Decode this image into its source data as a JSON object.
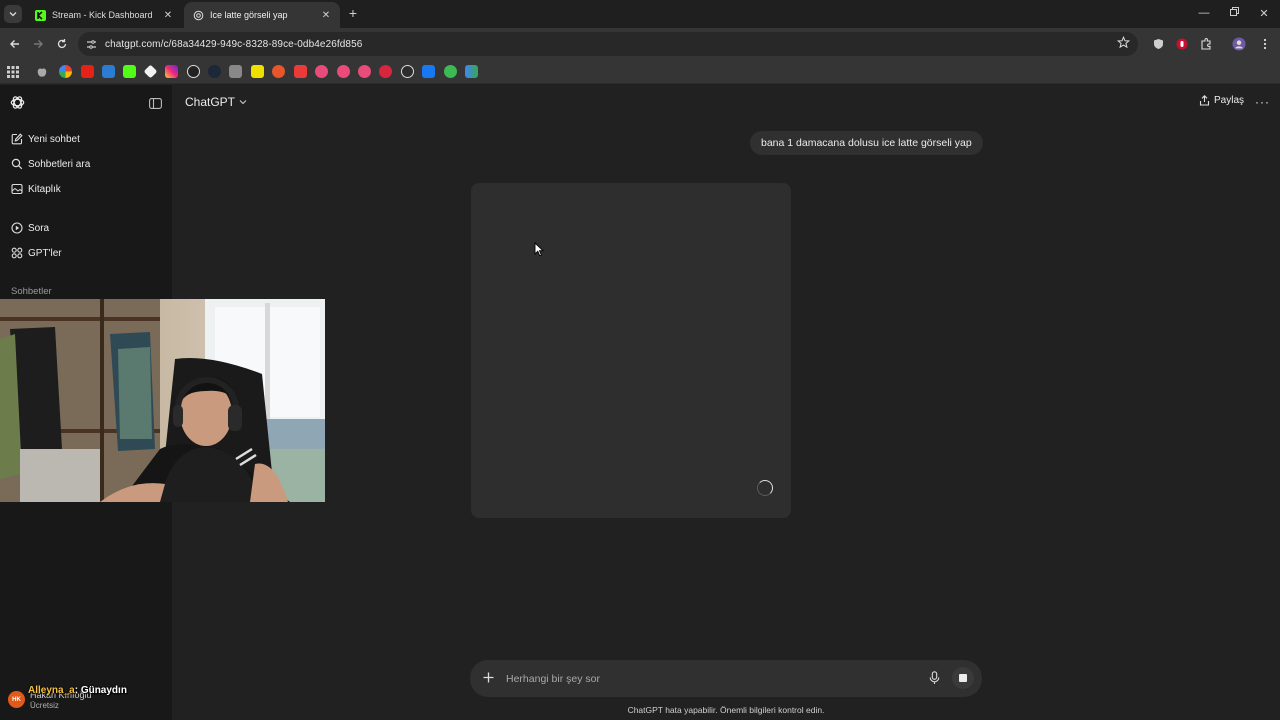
{
  "browser": {
    "tabs": [
      {
        "title": "Stream - Kick Dashboard",
        "favicon": "kick-icon",
        "active": false
      },
      {
        "title": "Ice latte görseli yap",
        "favicon": "openai-icon",
        "active": true
      }
    ],
    "url": "chatgpt.com/c/68a34429-949c-8328-89ce-0db4e26fd856"
  },
  "sidebar": {
    "items": [
      {
        "label": "Yeni sohbet",
        "icon": "new-chat-icon"
      },
      {
        "label": "Sohbetleri ara",
        "icon": "search-icon"
      },
      {
        "label": "Kitaplık",
        "icon": "library-icon"
      },
      {
        "label": "Sora",
        "icon": "play-circle-icon"
      },
      {
        "label": "GPT'ler",
        "icon": "grid-icon"
      }
    ],
    "section_title": "Sohbetler",
    "user": {
      "initials": "HK",
      "name": "Hakan Kırlıoğlu",
      "plan": "Ücretsiz"
    }
  },
  "overlay_chat": {
    "user": "Alleyna_a",
    "message": "Günaydın"
  },
  "header": {
    "model": "ChatGPT",
    "share_label": "Paylaş",
    "more_label": "···"
  },
  "conversation": {
    "user_message": "bana 1 damacana dolusu ice latte görseli yap"
  },
  "composer": {
    "placeholder": "Herhangi bir şey sor"
  },
  "disclaimer": "ChatGPT hata yapabilir. Önemli bilgileri kontrol edin.",
  "colors": {
    "accent_kick": "#53fc18",
    "avatar": "#e05a1c",
    "background": "#212121",
    "sidebar": "#181818"
  }
}
